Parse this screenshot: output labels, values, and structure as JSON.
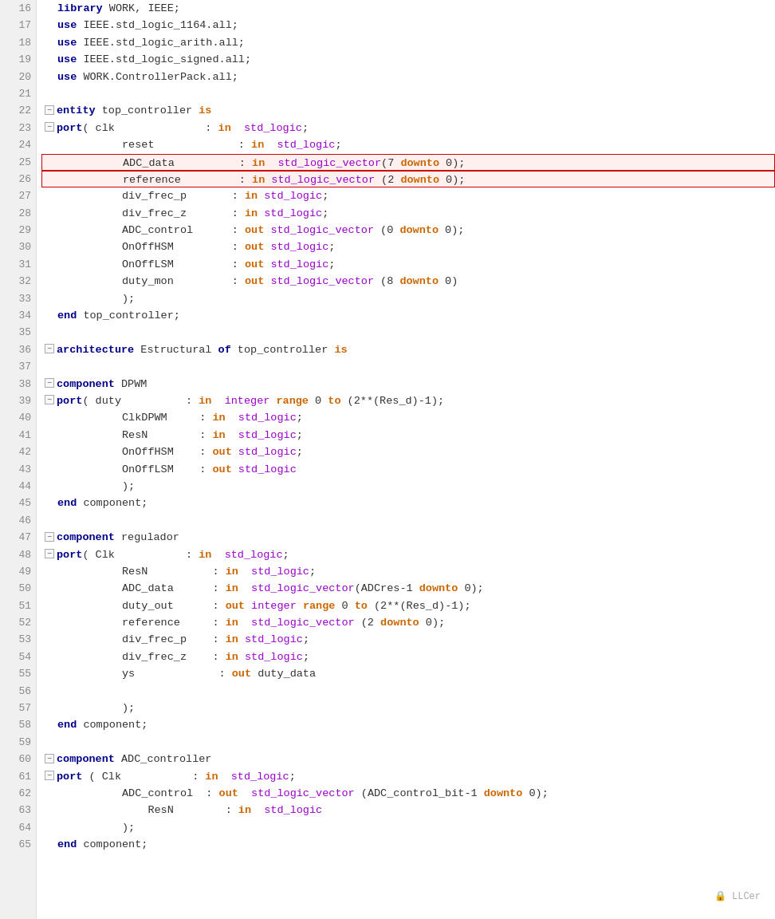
{
  "lines": [
    {
      "n": 16,
      "fold": false,
      "indent": 0,
      "tokens": [
        {
          "t": "library ",
          "c": "kw-blue"
        },
        {
          "t": "WORK, IEEE;",
          "c": "plain"
        }
      ]
    },
    {
      "n": 17,
      "fold": false,
      "indent": 1,
      "tokens": [
        {
          "t": "use ",
          "c": "kw-blue"
        },
        {
          "t": "IEEE.std_logic_1164.",
          "c": "plain"
        },
        {
          "t": "all",
          "c": "plain"
        },
        {
          "t": ";",
          "c": "plain"
        }
      ]
    },
    {
      "n": 18,
      "fold": false,
      "indent": 1,
      "tokens": [
        {
          "t": "use ",
          "c": "kw-blue"
        },
        {
          "t": "IEEE.std_logic_arith.",
          "c": "plain"
        },
        {
          "t": "all",
          "c": "plain"
        },
        {
          "t": ";",
          "c": "plain"
        }
      ]
    },
    {
      "n": 19,
      "fold": false,
      "indent": 1,
      "tokens": [
        {
          "t": "use ",
          "c": "kw-blue"
        },
        {
          "t": "IEEE.std_logic_signed.",
          "c": "plain"
        },
        {
          "t": "all",
          "c": "plain"
        },
        {
          "t": ";",
          "c": "plain"
        }
      ]
    },
    {
      "n": 20,
      "fold": false,
      "indent": 1,
      "tokens": [
        {
          "t": "use ",
          "c": "kw-blue"
        },
        {
          "t": "WORK.ControllerPack.",
          "c": "plain"
        },
        {
          "t": "all",
          "c": "plain"
        },
        {
          "t": ";",
          "c": "plain"
        }
      ]
    },
    {
      "n": 21,
      "fold": false,
      "indent": 0,
      "tokens": []
    },
    {
      "n": 22,
      "fold": true,
      "indent": 0,
      "tokens": [
        {
          "t": "entity ",
          "c": "kw-blue"
        },
        {
          "t": "top_controller ",
          "c": "plain"
        },
        {
          "t": "is",
          "c": "kw-orange"
        }
      ]
    },
    {
      "n": 23,
      "fold": true,
      "indent": 1,
      "tokens": [
        {
          "t": "port",
          "c": "kw-blue"
        },
        {
          "t": "( clk              : ",
          "c": "plain"
        },
        {
          "t": "in",
          "c": "kw-orange"
        },
        {
          "t": "  ",
          "c": "plain"
        },
        {
          "t": "std_logic",
          "c": "type-purple"
        },
        {
          "t": ";",
          "c": "plain"
        }
      ]
    },
    {
      "n": 24,
      "fold": false,
      "indent": 0,
      "tokens": [
        {
          "t": "          reset             : ",
          "c": "plain"
        },
        {
          "t": "in",
          "c": "kw-orange"
        },
        {
          "t": "  ",
          "c": "plain"
        },
        {
          "t": "std_logic",
          "c": "type-purple"
        },
        {
          "t": ";",
          "c": "plain"
        }
      ]
    },
    {
      "n": 25,
      "fold": false,
      "highlight": true,
      "indent": 0,
      "tokens": [
        {
          "t": "          ADC_data          : ",
          "c": "plain"
        },
        {
          "t": "in",
          "c": "kw-orange"
        },
        {
          "t": "  ",
          "c": "plain"
        },
        {
          "t": "std_logic_vector",
          "c": "type-purple"
        },
        {
          "t": "(7 ",
          "c": "plain"
        },
        {
          "t": "downto",
          "c": "range-kw"
        },
        {
          "t": " 0);",
          "c": "plain"
        }
      ]
    },
    {
      "n": 26,
      "fold": false,
      "highlight": true,
      "indent": 0,
      "tokens": [
        {
          "t": "          reference         : ",
          "c": "plain"
        },
        {
          "t": "in",
          "c": "kw-orange"
        },
        {
          "t": " ",
          "c": "plain"
        },
        {
          "t": "std_logic_vector",
          "c": "type-purple"
        },
        {
          "t": " (2 ",
          "c": "plain"
        },
        {
          "t": "downto",
          "c": "range-kw"
        },
        {
          "t": " 0);",
          "c": "plain"
        }
      ]
    },
    {
      "n": 27,
      "fold": false,
      "indent": 0,
      "tokens": [
        {
          "t": "          div_frec_p       : ",
          "c": "plain"
        },
        {
          "t": "in",
          "c": "kw-orange"
        },
        {
          "t": " ",
          "c": "plain"
        },
        {
          "t": "std_logic",
          "c": "type-purple"
        },
        {
          "t": ";",
          "c": "plain"
        }
      ]
    },
    {
      "n": 28,
      "fold": false,
      "indent": 0,
      "tokens": [
        {
          "t": "          div_frec_z       : ",
          "c": "plain"
        },
        {
          "t": "in",
          "c": "kw-orange"
        },
        {
          "t": " ",
          "c": "plain"
        },
        {
          "t": "std_logic",
          "c": "type-purple"
        },
        {
          "t": ";",
          "c": "plain"
        }
      ]
    },
    {
      "n": 29,
      "fold": false,
      "indent": 0,
      "tokens": [
        {
          "t": "          ADC_control      : ",
          "c": "plain"
        },
        {
          "t": "out",
          "c": "kw-orange"
        },
        {
          "t": " ",
          "c": "plain"
        },
        {
          "t": "std_logic_vector",
          "c": "type-purple"
        },
        {
          "t": " (0 ",
          "c": "plain"
        },
        {
          "t": "downto",
          "c": "range-kw"
        },
        {
          "t": " 0);",
          "c": "plain"
        }
      ]
    },
    {
      "n": 30,
      "fold": false,
      "indent": 0,
      "tokens": [
        {
          "t": "          OnOffHSM         : ",
          "c": "plain"
        },
        {
          "t": "out",
          "c": "kw-orange"
        },
        {
          "t": " ",
          "c": "plain"
        },
        {
          "t": "std_logic",
          "c": "type-purple"
        },
        {
          "t": ";",
          "c": "plain"
        }
      ]
    },
    {
      "n": 31,
      "fold": false,
      "indent": 0,
      "tokens": [
        {
          "t": "          OnOffLSM         : ",
          "c": "plain"
        },
        {
          "t": "out",
          "c": "kw-orange"
        },
        {
          "t": " ",
          "c": "plain"
        },
        {
          "t": "std_logic",
          "c": "type-purple"
        },
        {
          "t": ";",
          "c": "plain"
        }
      ]
    },
    {
      "n": 32,
      "fold": false,
      "indent": 0,
      "tokens": [
        {
          "t": "          duty_mon         : ",
          "c": "plain"
        },
        {
          "t": "out",
          "c": "kw-orange"
        },
        {
          "t": " ",
          "c": "plain"
        },
        {
          "t": "std_logic_vector",
          "c": "type-purple"
        },
        {
          "t": " (8 ",
          "c": "plain"
        },
        {
          "t": "downto",
          "c": "range-kw"
        },
        {
          "t": " 0)",
          "c": "plain"
        }
      ]
    },
    {
      "n": 33,
      "fold": false,
      "indent": 0,
      "tokens": [
        {
          "t": "          );",
          "c": "plain"
        }
      ]
    },
    {
      "n": 34,
      "fold": false,
      "indent": 0,
      "tokens": [
        {
          "t": "end ",
          "c": "kw-blue"
        },
        {
          "t": "top_controller;",
          "c": "plain"
        }
      ]
    },
    {
      "n": 35,
      "fold": false,
      "indent": 0,
      "tokens": []
    },
    {
      "n": 36,
      "fold": true,
      "indent": 0,
      "tokens": [
        {
          "t": "architecture ",
          "c": "kw-blue"
        },
        {
          "t": "Estructural ",
          "c": "plain"
        },
        {
          "t": "of ",
          "c": "kw-blue"
        },
        {
          "t": "top_controller ",
          "c": "plain"
        },
        {
          "t": "is",
          "c": "kw-orange"
        }
      ]
    },
    {
      "n": 37,
      "fold": false,
      "indent": 0,
      "tokens": []
    },
    {
      "n": 38,
      "fold": true,
      "indent": 1,
      "tokens": [
        {
          "t": "component ",
          "c": "kw-blue"
        },
        {
          "t": "DPWM",
          "c": "plain"
        }
      ]
    },
    {
      "n": 39,
      "fold": true,
      "indent": 1,
      "tokens": [
        {
          "t": "port",
          "c": "kw-blue"
        },
        {
          "t": "( duty          : ",
          "c": "plain"
        },
        {
          "t": "in",
          "c": "kw-orange"
        },
        {
          "t": "  ",
          "c": "plain"
        },
        {
          "t": "integer",
          "c": "type-purple"
        },
        {
          "t": " ",
          "c": "plain"
        },
        {
          "t": "range",
          "c": "range-kw"
        },
        {
          "t": " 0 ",
          "c": "plain"
        },
        {
          "t": "to",
          "c": "range-kw"
        },
        {
          "t": " (2**(Res_d)-1);",
          "c": "plain"
        }
      ]
    },
    {
      "n": 40,
      "fold": false,
      "indent": 0,
      "tokens": [
        {
          "t": "          ClkDPWM     : ",
          "c": "plain"
        },
        {
          "t": "in",
          "c": "kw-orange"
        },
        {
          "t": "  ",
          "c": "plain"
        },
        {
          "t": "std_logic",
          "c": "type-purple"
        },
        {
          "t": ";",
          "c": "plain"
        }
      ]
    },
    {
      "n": 41,
      "fold": false,
      "indent": 0,
      "tokens": [
        {
          "t": "          ResN        : ",
          "c": "plain"
        },
        {
          "t": "in",
          "c": "kw-orange"
        },
        {
          "t": "  ",
          "c": "plain"
        },
        {
          "t": "std_logic",
          "c": "type-purple"
        },
        {
          "t": ";",
          "c": "plain"
        }
      ]
    },
    {
      "n": 42,
      "fold": false,
      "indent": 0,
      "tokens": [
        {
          "t": "          OnOffHSM    : ",
          "c": "plain"
        },
        {
          "t": "out",
          "c": "kw-orange"
        },
        {
          "t": " ",
          "c": "plain"
        },
        {
          "t": "std_logic",
          "c": "type-purple"
        },
        {
          "t": ";",
          "c": "plain"
        }
      ]
    },
    {
      "n": 43,
      "fold": false,
      "indent": 0,
      "tokens": [
        {
          "t": "          OnOffLSM    : ",
          "c": "plain"
        },
        {
          "t": "out",
          "c": "kw-orange"
        },
        {
          "t": " ",
          "c": "plain"
        },
        {
          "t": "std_logic",
          "c": "type-purple"
        }
      ]
    },
    {
      "n": 44,
      "fold": false,
      "indent": 0,
      "tokens": [
        {
          "t": "          );",
          "c": "plain"
        }
      ]
    },
    {
      "n": 45,
      "fold": false,
      "indent": 1,
      "tokens": [
        {
          "t": "end ",
          "c": "kw-blue"
        },
        {
          "t": "component;",
          "c": "plain"
        }
      ]
    },
    {
      "n": 46,
      "fold": false,
      "indent": 0,
      "tokens": []
    },
    {
      "n": 47,
      "fold": true,
      "indent": 1,
      "tokens": [
        {
          "t": "component ",
          "c": "kw-blue"
        },
        {
          "t": "regulador",
          "c": "plain"
        }
      ]
    },
    {
      "n": 48,
      "fold": true,
      "indent": 1,
      "tokens": [
        {
          "t": "port",
          "c": "kw-blue"
        },
        {
          "t": "( Clk           : ",
          "c": "plain"
        },
        {
          "t": "in",
          "c": "kw-orange"
        },
        {
          "t": "  ",
          "c": "plain"
        },
        {
          "t": "std_logic",
          "c": "type-purple"
        },
        {
          "t": ";",
          "c": "plain"
        }
      ]
    },
    {
      "n": 49,
      "fold": false,
      "indent": 0,
      "tokens": [
        {
          "t": "          ResN          : ",
          "c": "plain"
        },
        {
          "t": "in",
          "c": "kw-orange"
        },
        {
          "t": "  ",
          "c": "plain"
        },
        {
          "t": "std_logic",
          "c": "type-purple"
        },
        {
          "t": ";",
          "c": "plain"
        }
      ]
    },
    {
      "n": 50,
      "fold": false,
      "indent": 0,
      "tokens": [
        {
          "t": "          ADC_data      : ",
          "c": "plain"
        },
        {
          "t": "in",
          "c": "kw-orange"
        },
        {
          "t": "  ",
          "c": "plain"
        },
        {
          "t": "std_logic_vector",
          "c": "type-purple"
        },
        {
          "t": "(ADCres-1 ",
          "c": "plain"
        },
        {
          "t": "downto",
          "c": "range-kw"
        },
        {
          "t": " 0);",
          "c": "plain"
        }
      ]
    },
    {
      "n": 51,
      "fold": false,
      "indent": 0,
      "tokens": [
        {
          "t": "          duty_out      : ",
          "c": "plain"
        },
        {
          "t": "out",
          "c": "kw-orange"
        },
        {
          "t": " ",
          "c": "plain"
        },
        {
          "t": "integer",
          "c": "type-purple"
        },
        {
          "t": " ",
          "c": "plain"
        },
        {
          "t": "range",
          "c": "range-kw"
        },
        {
          "t": " 0 ",
          "c": "plain"
        },
        {
          "t": "to",
          "c": "range-kw"
        },
        {
          "t": " (2**(Res_d)-1);",
          "c": "plain"
        }
      ]
    },
    {
      "n": 52,
      "fold": false,
      "indent": 0,
      "tokens": [
        {
          "t": "          reference     : ",
          "c": "plain"
        },
        {
          "t": "in",
          "c": "kw-orange"
        },
        {
          "t": "  ",
          "c": "plain"
        },
        {
          "t": "std_logic_vector",
          "c": "type-purple"
        },
        {
          "t": " (2 ",
          "c": "plain"
        },
        {
          "t": "downto",
          "c": "range-kw"
        },
        {
          "t": " 0);",
          "c": "plain"
        }
      ]
    },
    {
      "n": 53,
      "fold": false,
      "indent": 0,
      "tokens": [
        {
          "t": "          div_frec_p    : ",
          "c": "plain"
        },
        {
          "t": "in",
          "c": "kw-orange"
        },
        {
          "t": " ",
          "c": "plain"
        },
        {
          "t": "std_logic",
          "c": "type-purple"
        },
        {
          "t": ";",
          "c": "plain"
        }
      ]
    },
    {
      "n": 54,
      "fold": false,
      "indent": 0,
      "tokens": [
        {
          "t": "          div_frec_z    : ",
          "c": "plain"
        },
        {
          "t": "in",
          "c": "kw-orange"
        },
        {
          "t": " ",
          "c": "plain"
        },
        {
          "t": "std_logic",
          "c": "type-purple"
        },
        {
          "t": ";",
          "c": "plain"
        }
      ]
    },
    {
      "n": 55,
      "fold": false,
      "indent": 0,
      "tokens": [
        {
          "t": "          ys             : ",
          "c": "plain"
        },
        {
          "t": "out",
          "c": "kw-orange"
        },
        {
          "t": " duty_data",
          "c": "plain"
        }
      ]
    },
    {
      "n": 56,
      "fold": false,
      "indent": 0,
      "tokens": []
    },
    {
      "n": 57,
      "fold": false,
      "indent": 0,
      "tokens": [
        {
          "t": "          );",
          "c": "plain"
        }
      ]
    },
    {
      "n": 58,
      "fold": false,
      "indent": 1,
      "tokens": [
        {
          "t": "end ",
          "c": "kw-blue"
        },
        {
          "t": "component;",
          "c": "plain"
        }
      ]
    },
    {
      "n": 59,
      "fold": false,
      "indent": 0,
      "tokens": []
    },
    {
      "n": 60,
      "fold": true,
      "indent": 1,
      "tokens": [
        {
          "t": "component ",
          "c": "kw-blue"
        },
        {
          "t": "ADC_controller",
          "c": "plain"
        }
      ]
    },
    {
      "n": 61,
      "fold": true,
      "indent": 1,
      "tokens": [
        {
          "t": "port ",
          "c": "kw-blue"
        },
        {
          "t": "( Clk           : ",
          "c": "plain"
        },
        {
          "t": "in",
          "c": "kw-orange"
        },
        {
          "t": "  ",
          "c": "plain"
        },
        {
          "t": "std_logic",
          "c": "type-purple"
        },
        {
          "t": ";",
          "c": "plain"
        }
      ]
    },
    {
      "n": 62,
      "fold": false,
      "indent": 0,
      "tokens": [
        {
          "t": "          ADC_control  : ",
          "c": "plain"
        },
        {
          "t": "out",
          "c": "kw-orange"
        },
        {
          "t": "  ",
          "c": "plain"
        },
        {
          "t": "std_logic_vector",
          "c": "type-purple"
        },
        {
          "t": " (ADC_control_bit-1 ",
          "c": "plain"
        },
        {
          "t": "downto",
          "c": "range-kw"
        },
        {
          "t": " 0);",
          "c": "plain"
        }
      ]
    },
    {
      "n": 63,
      "fold": false,
      "indent": 0,
      "tokens": [
        {
          "t": "              ResN        : ",
          "c": "plain"
        },
        {
          "t": "in",
          "c": "kw-orange"
        },
        {
          "t": "  ",
          "c": "plain"
        },
        {
          "t": "std_logic",
          "c": "type-purple"
        }
      ]
    },
    {
      "n": 64,
      "fold": false,
      "indent": 0,
      "tokens": [
        {
          "t": "          );",
          "c": "plain"
        }
      ]
    },
    {
      "n": 65,
      "fold": false,
      "indent": 1,
      "tokens": [
        {
          "t": "end ",
          "c": "kw-blue"
        },
        {
          "t": "component;",
          "c": "plain"
        }
      ]
    }
  ],
  "watermark": "🔒 LLCer",
  "fold_minus": "−",
  "fold_plus": "+"
}
